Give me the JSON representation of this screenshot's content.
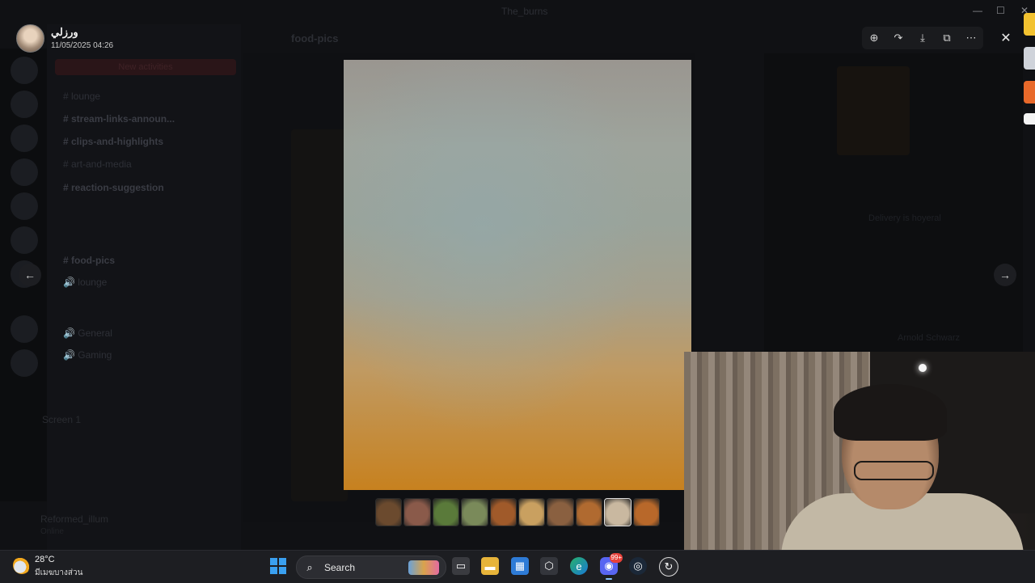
{
  "window": {
    "title": "The_burns",
    "controls": {
      "minimize": "—",
      "maximize": "☐",
      "close": "✕"
    }
  },
  "background": {
    "new_activity": "New activities",
    "channel_header_title": "food-pics",
    "channels": [
      {
        "label": "# lounge",
        "bold": false
      },
      {
        "label": "# stream-links-announ...",
        "bold": true
      },
      {
        "label": "# clips-and-highlights",
        "bold": true
      },
      {
        "label": "# art-and-media",
        "bold": false
      },
      {
        "label": "# reaction-suggestion",
        "bold": true
      },
      {
        "label": "# food-pics",
        "bold": true
      },
      {
        "label": "🔊 lounge",
        "bold": false
      },
      {
        "label": "🔊 General",
        "bold": false
      },
      {
        "label": "🔊 Gaming",
        "bold": false
      }
    ],
    "screen_label": "Screen 1",
    "user_name": "Reformed_illum",
    "user_status": "Online",
    "right_panel": {
      "delivery": "Delivery is hoyeral",
      "member_line": "Arnold Schwarz"
    }
  },
  "viewer": {
    "uploader_name": "ورزلي",
    "upload_date": "11/05/2025 04:26",
    "toolbar": [
      {
        "icon": "zoom-in-icon",
        "glyph": "⊕"
      },
      {
        "icon": "forward-icon",
        "glyph": "↷"
      },
      {
        "icon": "download-icon",
        "glyph": "⤓"
      },
      {
        "icon": "open-external-icon",
        "glyph": "⧉"
      },
      {
        "icon": "more-icon",
        "glyph": "⋯"
      }
    ],
    "close_glyph": "✕",
    "prev_glyph": "←",
    "next_glyph": "→",
    "thumbnails": [
      {
        "color": "#6b4a2e",
        "selected": false
      },
      {
        "color": "#8a5a4a",
        "selected": false
      },
      {
        "color": "#5a7a3a",
        "selected": false
      },
      {
        "color": "#7a8a5a",
        "selected": false
      },
      {
        "color": "#a05a2a",
        "selected": false
      },
      {
        "color": "#c9a060",
        "selected": false
      },
      {
        "color": "#8a6040",
        "selected": false
      },
      {
        "color": "#b06a30",
        "selected": false
      },
      {
        "color": "#c9b8a0",
        "selected": true
      },
      {
        "color": "#b8682a",
        "selected": false
      }
    ]
  },
  "taskbar": {
    "weather_temp": "28°C",
    "weather_desc": "มีเมฆบางส่วน",
    "search_label": "Search",
    "discord_badge": "99+",
    "apps": [
      "task-view-icon",
      "file-explorer-icon",
      "store-icon",
      "app-icon",
      "edge-icon",
      "discord-icon",
      "steam-icon",
      "recorder-icon"
    ]
  }
}
